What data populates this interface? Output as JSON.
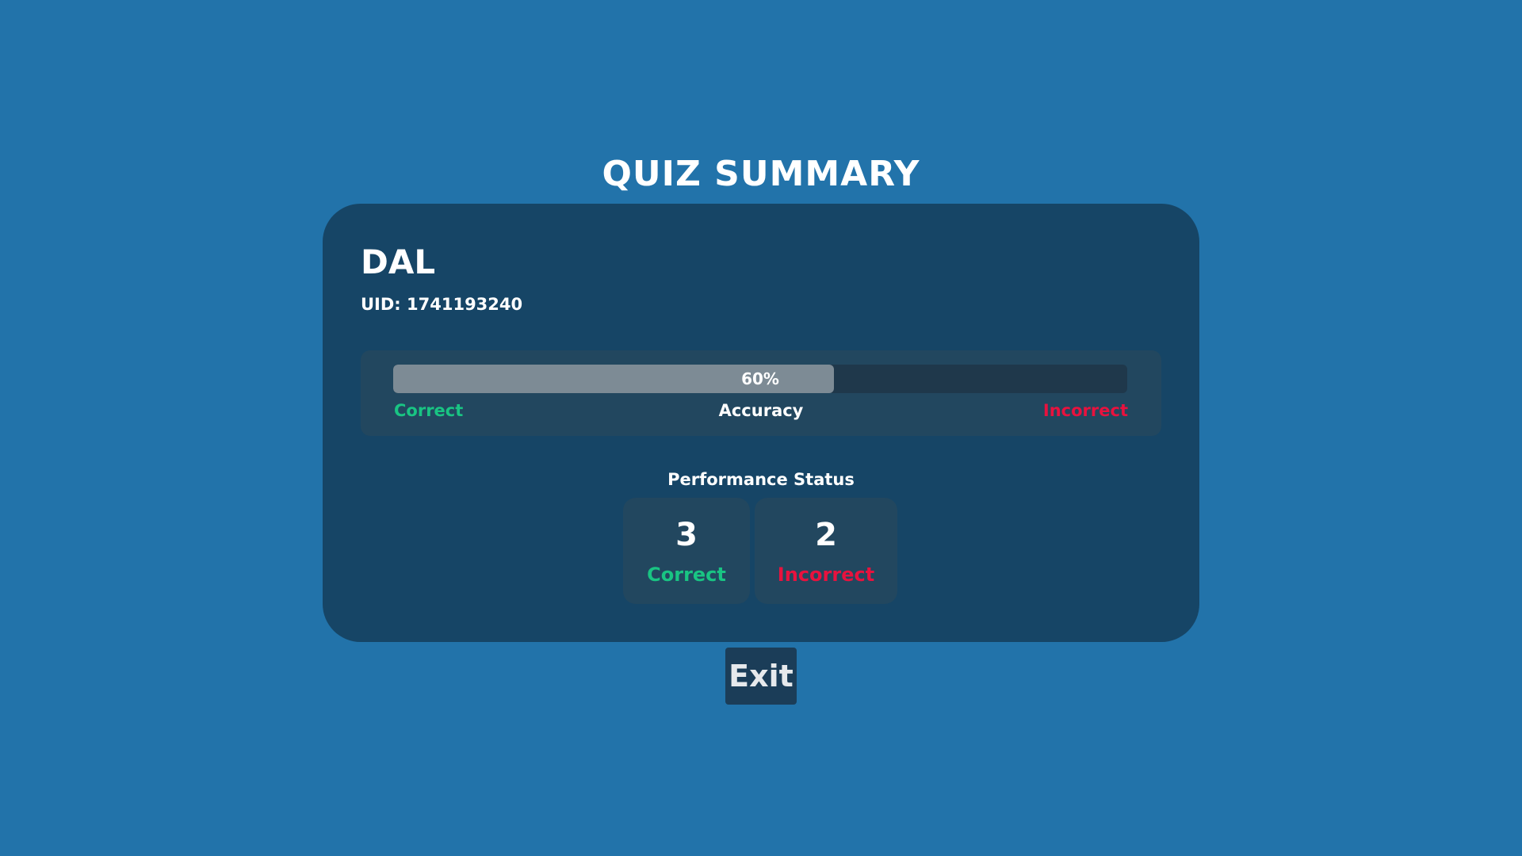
{
  "title": "QUIZ SUMMARY",
  "player": {
    "name": "DAL",
    "uid": "UID: 1741193240"
  },
  "accuracy": {
    "percent_text": "60%",
    "percent_value": 60,
    "correct_label": "Correct",
    "label": "Accuracy",
    "incorrect_label": "Incorrect"
  },
  "performance": {
    "title": "Performance Status",
    "correct_count": "3",
    "correct_label": "Correct",
    "incorrect_count": "2",
    "incorrect_label": "Incorrect"
  },
  "exit_label": "Exit",
  "colors": {
    "background": "#2273aa",
    "card": "#164566",
    "panel": "#22475f",
    "correct": "#19c483",
    "incorrect": "#e8123e",
    "bar_fill": "#7d8b95",
    "bar_track": "#1f384b"
  }
}
